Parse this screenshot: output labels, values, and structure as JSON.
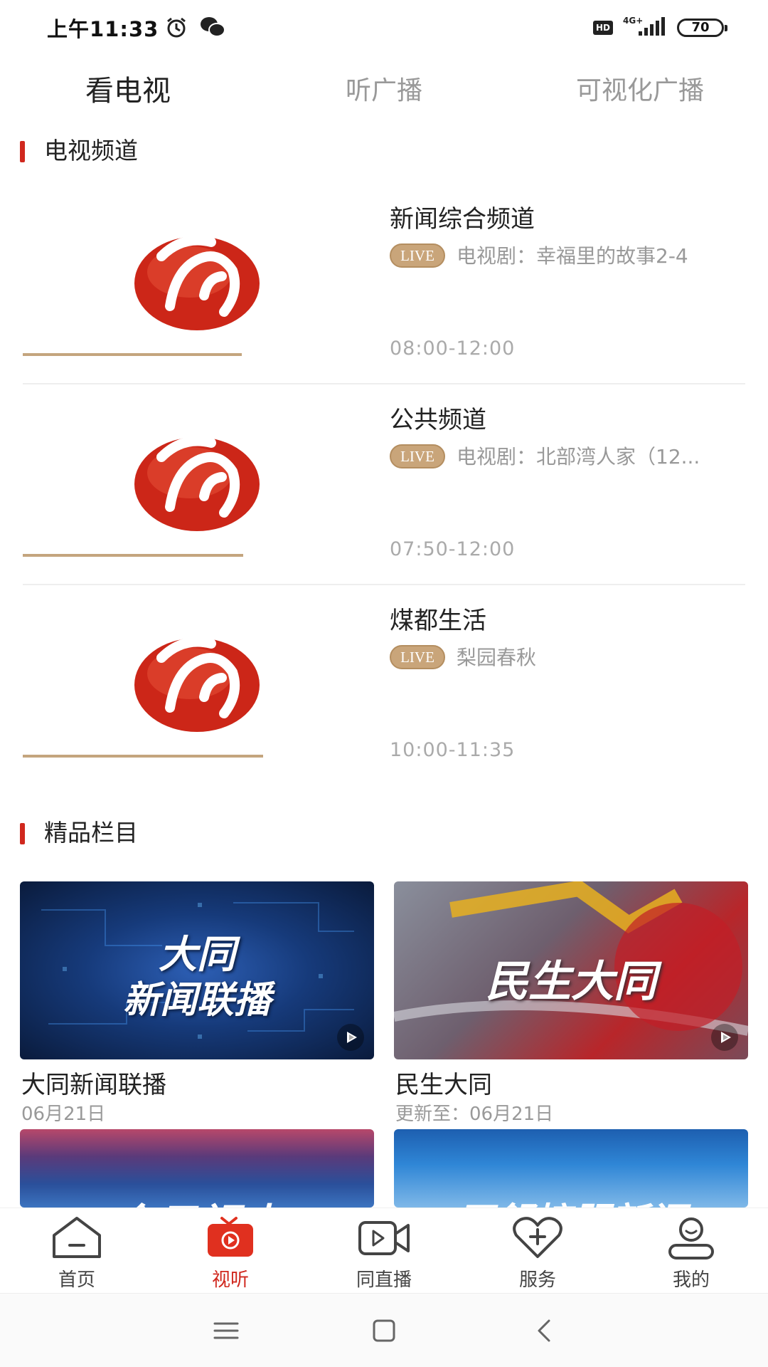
{
  "status_bar": {
    "time": "上午11:33",
    "network": "4G+",
    "hd": "HD",
    "battery": "70"
  },
  "top_tabs": [
    {
      "label": "看电视",
      "active": true
    },
    {
      "label": "听广播",
      "active": false
    },
    {
      "label": "可视化广播",
      "active": false
    }
  ],
  "tv_section": {
    "title": "电视频道"
  },
  "channels": [
    {
      "name": "新闻综合频道",
      "live": "LIVE",
      "program": "电视剧：幸福里的故事2-4",
      "time": "08:00-12:00"
    },
    {
      "name": "公共频道",
      "live": "LIVE",
      "program": "电视剧：北部湾人家（12...",
      "time": "07:50-12:00"
    },
    {
      "name": "煤都生活",
      "live": "LIVE",
      "program": "梨园春秋",
      "time": "10:00-11:35"
    }
  ],
  "featured_section": {
    "title": "精品栏目"
  },
  "programs": [
    {
      "title": "大同新闻联播",
      "date": "06月21日",
      "overlay_line1": "大同",
      "overlay_line2": "新闻联播"
    },
    {
      "title": "民生大同",
      "date": "更新至：06月21日",
      "overlay_line1": "民生大同"
    },
    {
      "overlay_line1": "今日视点"
    },
    {
      "overlay_line1": "平舒接服新闻"
    }
  ],
  "bottom_nav": [
    {
      "label": "首页",
      "icon": "home-icon",
      "active": false
    },
    {
      "label": "视听",
      "icon": "tv-play-icon",
      "active": true
    },
    {
      "label": "同直播",
      "icon": "video-camera-icon",
      "active": false
    },
    {
      "label": "服务",
      "icon": "heart-plus-icon",
      "active": false
    },
    {
      "label": "我的",
      "icon": "user-icon",
      "active": false
    }
  ],
  "colors": {
    "accent": "#d0281e",
    "gold": "#c4a57e",
    "muted": "#999999"
  }
}
